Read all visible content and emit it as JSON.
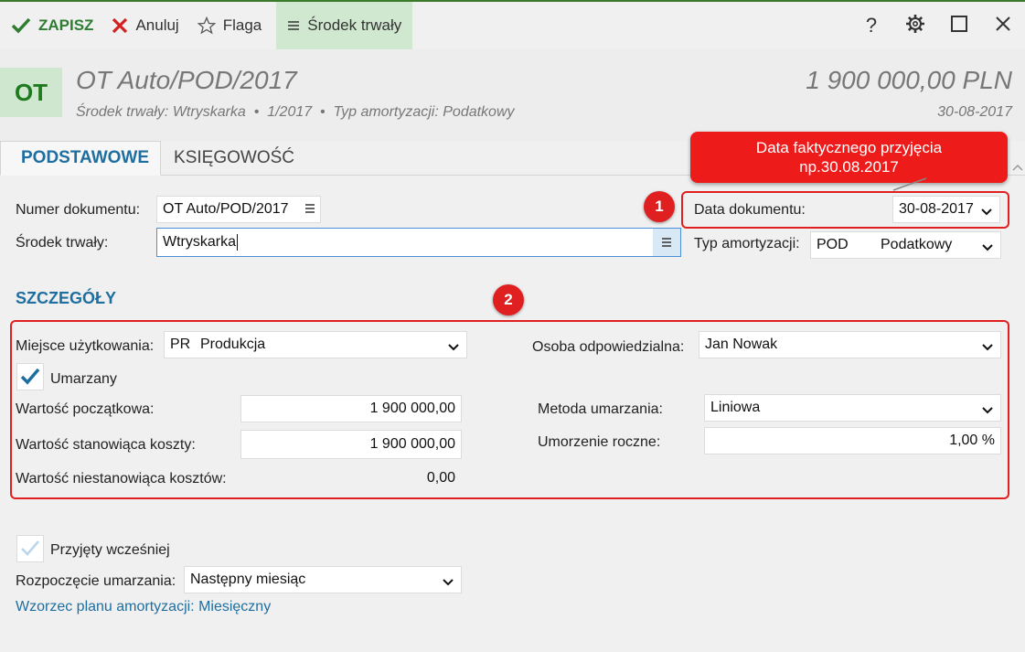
{
  "toolbar": {
    "save_label": "ZAPISZ",
    "cancel_label": "Anuluj",
    "flag_label": "Flaga",
    "tab_label": "Środek trwały"
  },
  "header": {
    "badge": "OT",
    "title": "OT Auto/POD/2017",
    "subtitle": "Środek trwały: Wtryskarka  •  1/2017  •  Typ amortyzacji: Podatkowy",
    "amount": "1 900 000,00 PLN",
    "date": "30-08-2017"
  },
  "tabs": [
    {
      "label": "PODSTAWOWE",
      "active": true
    },
    {
      "label": "KSIĘGOWOŚĆ",
      "active": false
    }
  ],
  "form": {
    "doc_number_label": "Numer dokumentu:",
    "doc_number_value": "OT Auto/POD/2017",
    "asset_label": "Środek trwały:",
    "asset_value": "Wtryskarka",
    "doc_date_label": "Data dokumentu:",
    "doc_date_value": "30-08-2017",
    "amort_type_label": "Typ amortyzacji:",
    "amort_type_code": "POD",
    "amort_type_value": "Podatkowy"
  },
  "details": {
    "section_title": "SZCZEGÓŁY",
    "place_label": "Miejsce użytkowania:",
    "place_code": "PR",
    "place_value": "Produkcja",
    "person_label": "Osoba odpowiedzialna:",
    "person_value": "Jan Nowak",
    "depreciated_label": "Umarzany",
    "initial_value_label": "Wartość początkowa:",
    "initial_value": "1 900 000,00",
    "cost_value_label": "Wartość stanowiąca koszty:",
    "cost_value": "1 900 000,00",
    "noncost_value_label": "Wartość niestanowiąca kosztów:",
    "noncost_value": "0,00",
    "method_label": "Metoda umarzania:",
    "method_value": "Liniowa",
    "annual_label": "Umorzenie roczne:",
    "annual_value": "1,00 %"
  },
  "lower": {
    "accepted_earlier_label": "Przyjęty wcześniej",
    "start_label": "Rozpoczęcie umarzania:",
    "start_value": "Następny miesiąc",
    "plan_link": "Wzorzec planu amortyzacji: Miesięczny"
  },
  "annotations": {
    "callout": "Data faktycznego przyjęcia\nnp.30.08.2017",
    "marker1": "1",
    "marker2": "2"
  },
  "colors": {
    "accent_green": "#2e7d32",
    "accent_blue": "#1f6ea0",
    "annotation_red": "#e02020"
  }
}
